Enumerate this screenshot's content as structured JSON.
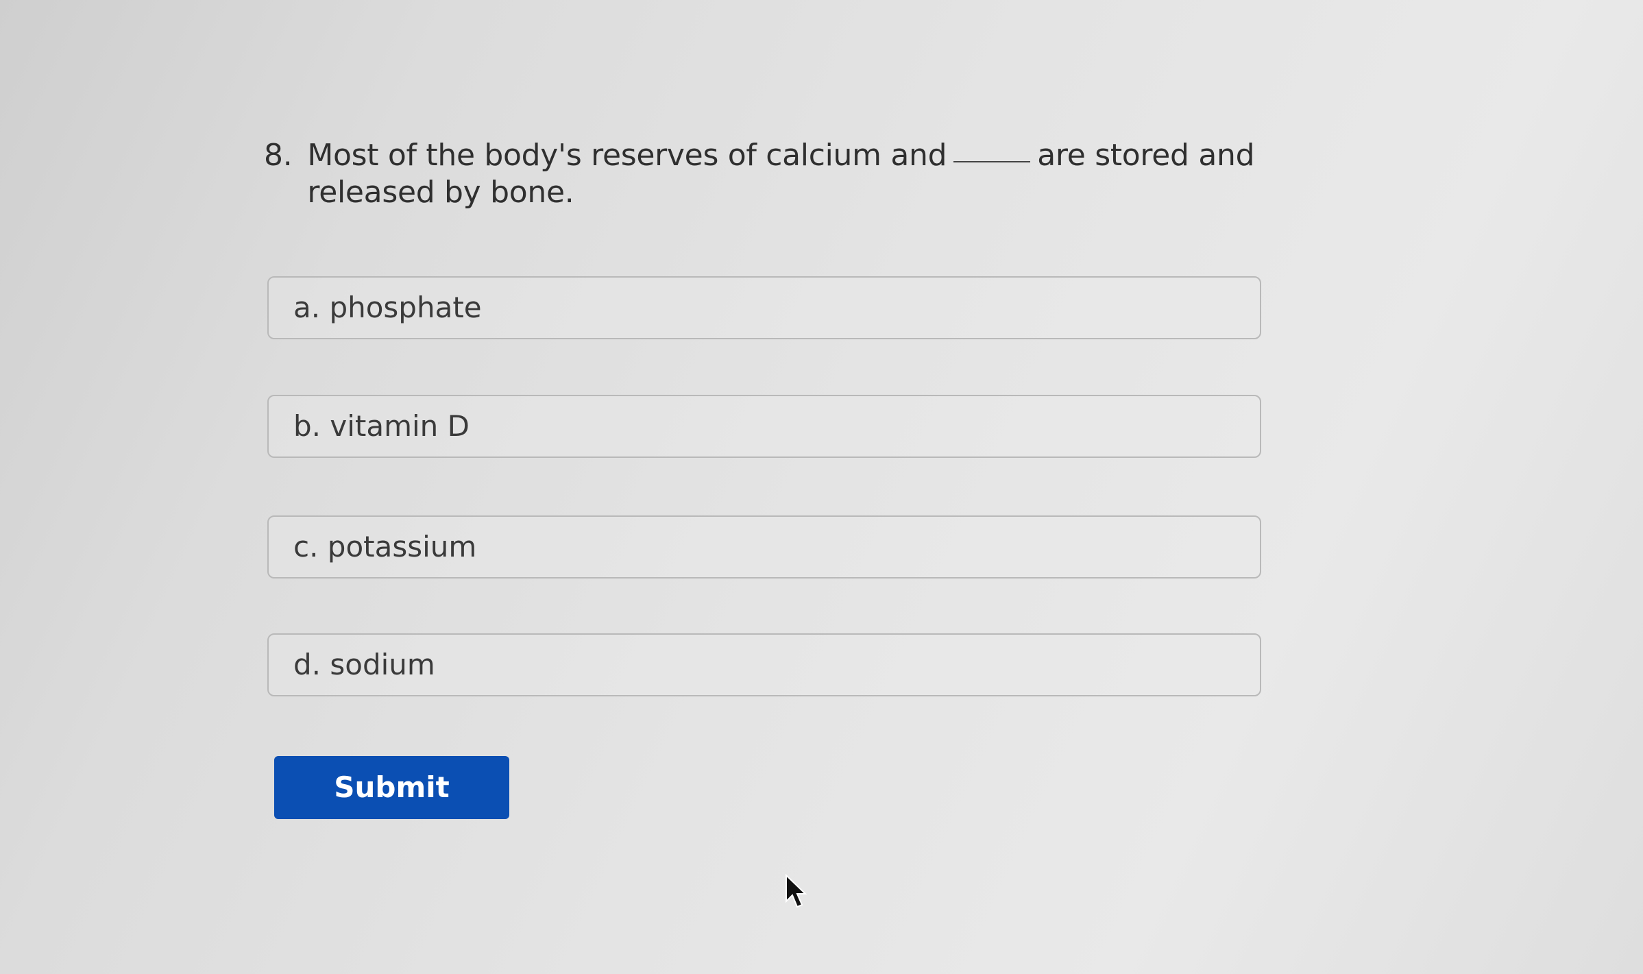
{
  "question": {
    "number": "8.",
    "text_before": "Most of the body's reserves of calcium and",
    "text_after": "are stored and released by bone."
  },
  "options": [
    {
      "label": "a. phosphate"
    },
    {
      "label": "b. vitamin D"
    },
    {
      "label": "c. potassium"
    },
    {
      "label": "d. sodium"
    }
  ],
  "submit": {
    "label": "Submit",
    "color": "#0b4fb3"
  },
  "cursor": {
    "icon": "arrow-cursor-icon"
  }
}
